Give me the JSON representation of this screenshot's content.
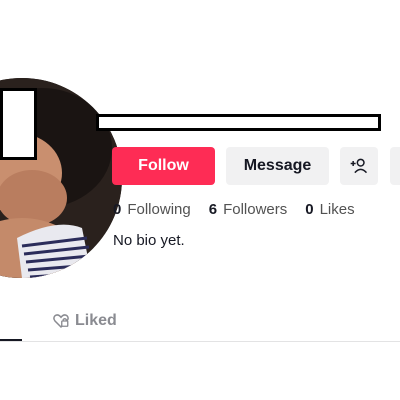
{
  "profile": {
    "follow_label": "Follow",
    "message_label": "Message",
    "add_user_icon": "add-user-icon",
    "more_icon": "more-icon",
    "bio": "No bio yet."
  },
  "stats": [
    {
      "value": "0",
      "label": "Following"
    },
    {
      "value": "6",
      "label": "Followers"
    },
    {
      "value": "0",
      "label": "Likes"
    }
  ],
  "tabs": {
    "liked_label": "Liked",
    "liked_icon": "heart-lock-icon"
  },
  "colors": {
    "accent": "#fe2c55",
    "button_bg": "#f1f1f2",
    "text": "#161823",
    "muted": "#8a8b91"
  }
}
